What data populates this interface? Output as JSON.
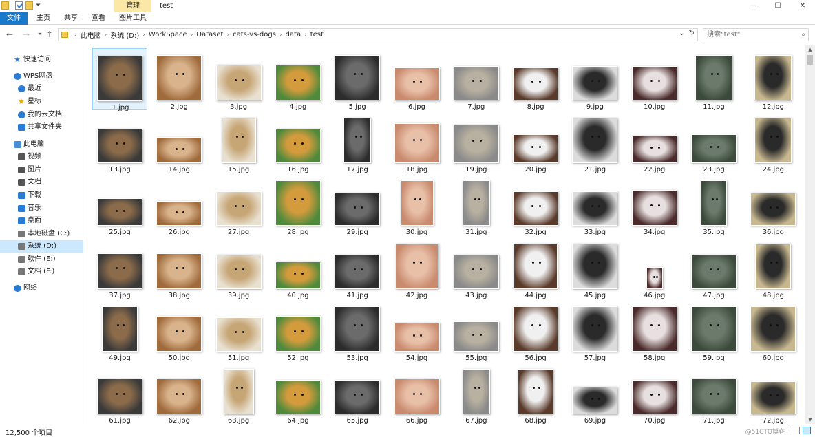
{
  "window": {
    "title": "test",
    "manage_tab": "管理",
    "tabs": [
      "文件",
      "主页",
      "共享",
      "查看",
      "图片工具"
    ],
    "controls": [
      "minimize-icon",
      "maximize-icon",
      "close-icon"
    ]
  },
  "address": {
    "breadcrumbs": [
      "此电脑",
      "系统 (D:)",
      "WorkSpace",
      "Dataset",
      "cats-vs-dogs",
      "data",
      "test"
    ],
    "search_placeholder": "搜索\"test\""
  },
  "sidebar": {
    "items": [
      {
        "label": "快速访问",
        "icon": "star-icon",
        "color": "#2b7bd3"
      },
      {
        "label": "WPS网盘",
        "icon": "cloud-icon",
        "color": "#2b7bd3"
      },
      {
        "label": "最近",
        "icon": "clock-icon",
        "color": "#2b7bd3"
      },
      {
        "label": "星标",
        "icon": "star-icon",
        "color": "#f0a500"
      },
      {
        "label": "我的云文档",
        "icon": "cloud-icon",
        "color": "#2b7bd3"
      },
      {
        "label": "共享文件夹",
        "icon": "share-icon",
        "color": "#2b7bd3"
      },
      {
        "label": "此电脑",
        "icon": "computer-icon",
        "color": "#4a90d9"
      },
      {
        "label": "视频",
        "icon": "video-icon",
        "color": "#555555"
      },
      {
        "label": "图片",
        "icon": "picture-icon",
        "color": "#555555"
      },
      {
        "label": "文档",
        "icon": "document-icon",
        "color": "#555555"
      },
      {
        "label": "下载",
        "icon": "download-icon",
        "color": "#2b7bd3"
      },
      {
        "label": "音乐",
        "icon": "music-icon",
        "color": "#2b7bd3"
      },
      {
        "label": "桌面",
        "icon": "desktop-icon",
        "color": "#2b7bd3"
      },
      {
        "label": "本地磁盘 (C:)",
        "icon": "drive-icon",
        "color": "#777777"
      },
      {
        "label": "系统 (D:)",
        "icon": "drive-icon",
        "color": "#777777"
      },
      {
        "label": "软件 (E:)",
        "icon": "drive-icon",
        "color": "#777777"
      },
      {
        "label": "文档 (F:)",
        "icon": "drive-icon",
        "color": "#777777"
      },
      {
        "label": "网络",
        "icon": "network-icon",
        "color": "#2b7bd3"
      }
    ],
    "selected_index": 14
  },
  "files": [
    "1.jpg",
    "2.jpg",
    "3.jpg",
    "4.jpg",
    "5.jpg",
    "6.jpg",
    "7.jpg",
    "8.jpg",
    "9.jpg",
    "10.jpg",
    "11.jpg",
    "12.jpg",
    "13.jpg",
    "14.jpg",
    "15.jpg",
    "16.jpg",
    "17.jpg",
    "18.jpg",
    "19.jpg",
    "20.jpg",
    "21.jpg",
    "22.jpg",
    "23.jpg",
    "24.jpg",
    "25.jpg",
    "26.jpg",
    "27.jpg",
    "28.jpg",
    "29.jpg",
    "30.jpg",
    "31.jpg",
    "32.jpg",
    "33.jpg",
    "34.jpg",
    "35.jpg",
    "36.jpg",
    "37.jpg",
    "38.jpg",
    "39.jpg",
    "40.jpg",
    "41.jpg",
    "42.jpg",
    "43.jpg",
    "44.jpg",
    "45.jpg",
    "46.jpg",
    "47.jpg",
    "48.jpg",
    "49.jpg",
    "50.jpg",
    "51.jpg",
    "52.jpg",
    "53.jpg",
    "54.jpg",
    "55.jpg",
    "56.jpg",
    "57.jpg",
    "58.jpg",
    "59.jpg",
    "60.jpg",
    "61.jpg",
    "62.jpg",
    "63.jpg",
    "64.jpg",
    "65.jpg",
    "66.jpg",
    "67.jpg",
    "68.jpg",
    "69.jpg",
    "70.jpg",
    "71.jpg",
    "72.jpg"
  ],
  "selected_file_index": 0,
  "status": {
    "item_count": "12,500 个项目",
    "watermark": "@51CTO博客"
  }
}
